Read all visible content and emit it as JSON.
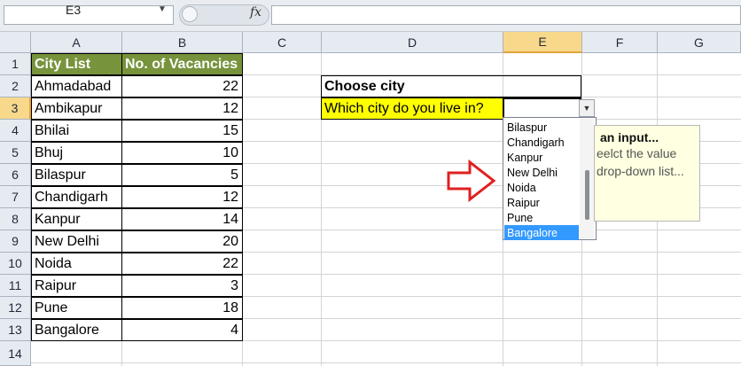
{
  "formula_bar": {
    "name_box": "E3",
    "fx_label": "fx",
    "formula": ""
  },
  "columns": [
    "A",
    "B",
    "C",
    "D",
    "E",
    "F",
    "G"
  ],
  "rows": [
    "1",
    "2",
    "3",
    "4",
    "5",
    "6",
    "7",
    "8",
    "9",
    "10",
    "11",
    "12",
    "13",
    "14"
  ],
  "active_cell": {
    "column": "E",
    "row": "3"
  },
  "table": {
    "headers": [
      "City List",
      "No. of Vacancies"
    ],
    "rows": [
      {
        "city": "Ahmadabad",
        "vacancies": "22"
      },
      {
        "city": "Ambikapur",
        "vacancies": "12"
      },
      {
        "city": "Bhilai",
        "vacancies": "15"
      },
      {
        "city": "Bhuj",
        "vacancies": "10"
      },
      {
        "city": "Bilaspur",
        "vacancies": "5"
      },
      {
        "city": "Chandigarh",
        "vacancies": "12"
      },
      {
        "city": "Kanpur",
        "vacancies": "14"
      },
      {
        "city": "New Delhi",
        "vacancies": "20"
      },
      {
        "city": "Noida",
        "vacancies": "22"
      },
      {
        "city": "Raipur",
        "vacancies": "3"
      },
      {
        "city": "Pune",
        "vacancies": "18"
      },
      {
        "city": "Bangalore",
        "vacancies": "4"
      }
    ]
  },
  "form": {
    "title": "Choose city",
    "question": "Which city do you live in?"
  },
  "dropdown": {
    "items": [
      "Bilaspur",
      "Chandigarh",
      "Kanpur",
      "New Delhi",
      "Noida",
      "Raipur",
      "Pune",
      "Bangalore"
    ],
    "selected": "Bangalore"
  },
  "input_message": {
    "title": "an input...",
    "line1": "eelct the value",
    "line2": "drop-down list..."
  },
  "colors": {
    "header_green": "#77933c",
    "highlight_yellow": "#ffff00",
    "selection_blue": "#3399ff",
    "arrow_red": "#e02020",
    "tooltip_bg": "#ffffe1"
  },
  "icons": {
    "arrow": "red-outline-right-arrow",
    "dropdown": "chevron-down-icon"
  }
}
